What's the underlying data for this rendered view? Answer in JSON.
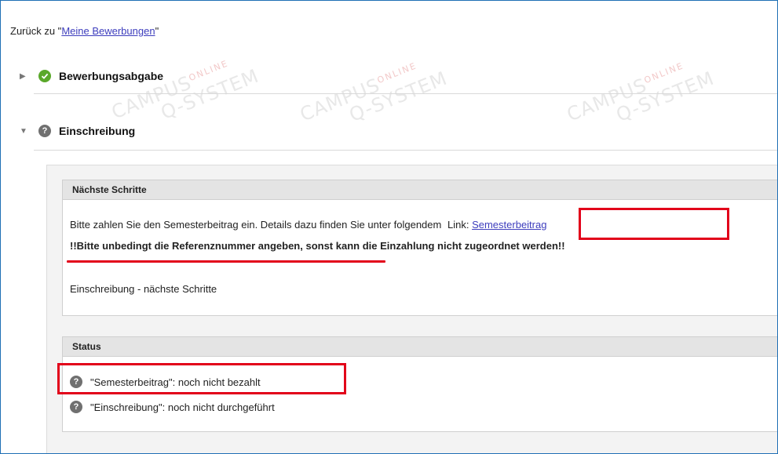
{
  "back": {
    "prefix": "Zurück zu \"",
    "link": "Meine Bewerbungen",
    "suffix": "\""
  },
  "sections": [
    {
      "title": "Bewerbungsabgabe",
      "state": "collapsed",
      "status": "check-icon"
    },
    {
      "title": "Einschreibung",
      "state": "expanded",
      "status": "help-icon"
    }
  ],
  "next_steps": {
    "heading": "Nächste Schritte",
    "text": "Bitte zahlen Sie den Semesterbeitrag ein. Details dazu finden Sie unter folgendem",
    "link_prefix": "Link:",
    "link": "Semesterbeitrag",
    "warning": "!!Bitte unbedingt die Referenznummer angeben, sonst kann die Einzahlung nicht zugeordnet werden!!",
    "sub": "Einschreibung - nächste Schritte"
  },
  "status": {
    "heading": "Status",
    "items": [
      "\"Semesterbeitrag\": noch nicht bezahlt",
      "\"Einschreibung\": noch nicht durchgeführt"
    ]
  },
  "watermark": {
    "line1": "CAMPUS",
    "online": "ONLINE",
    "line2": "Q-SYSTEM"
  },
  "colors": {
    "highlight": "#e2001a",
    "link": "#3d3dbd",
    "frame": "#1f6fb5",
    "ok": "#5aa82a"
  }
}
